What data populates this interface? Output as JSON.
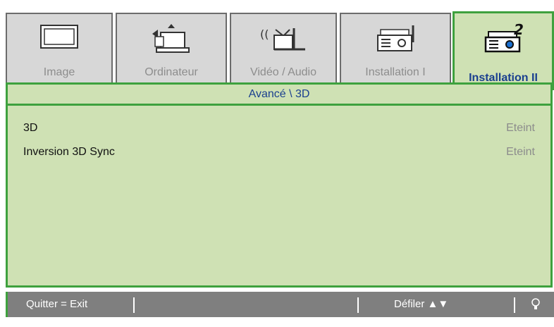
{
  "tabs": [
    {
      "label": "Image",
      "icon": "monitor-icon",
      "active": false
    },
    {
      "label": "Ordinateur",
      "icon": "laptop-icon",
      "active": false
    },
    {
      "label": "Vidéo / Audio",
      "icon": "tv-antenna-icon",
      "active": false
    },
    {
      "label": "Installation I",
      "icon": "projector-icon",
      "active": false
    },
    {
      "label": "Installation II",
      "icon": "projector-2-icon",
      "active": true
    }
  ],
  "section": {
    "title": "Avancé \\ 3D"
  },
  "settings": [
    {
      "name": "3D",
      "value": "Eteint"
    },
    {
      "name": "Inversion 3D Sync",
      "value": "Eteint"
    }
  ],
  "footer": {
    "exit_label": "Quitter = Exit",
    "scroll_label": "Défiler ▲▼",
    "lamp_icon": "bulb-icon"
  },
  "colors": {
    "accent_green": "#3ea13e",
    "panel_bg": "#cfe1b4",
    "active_label": "#1a3f8f",
    "inactive_tab": "#d7d7d7",
    "footer_bg": "#7f7f7f"
  }
}
